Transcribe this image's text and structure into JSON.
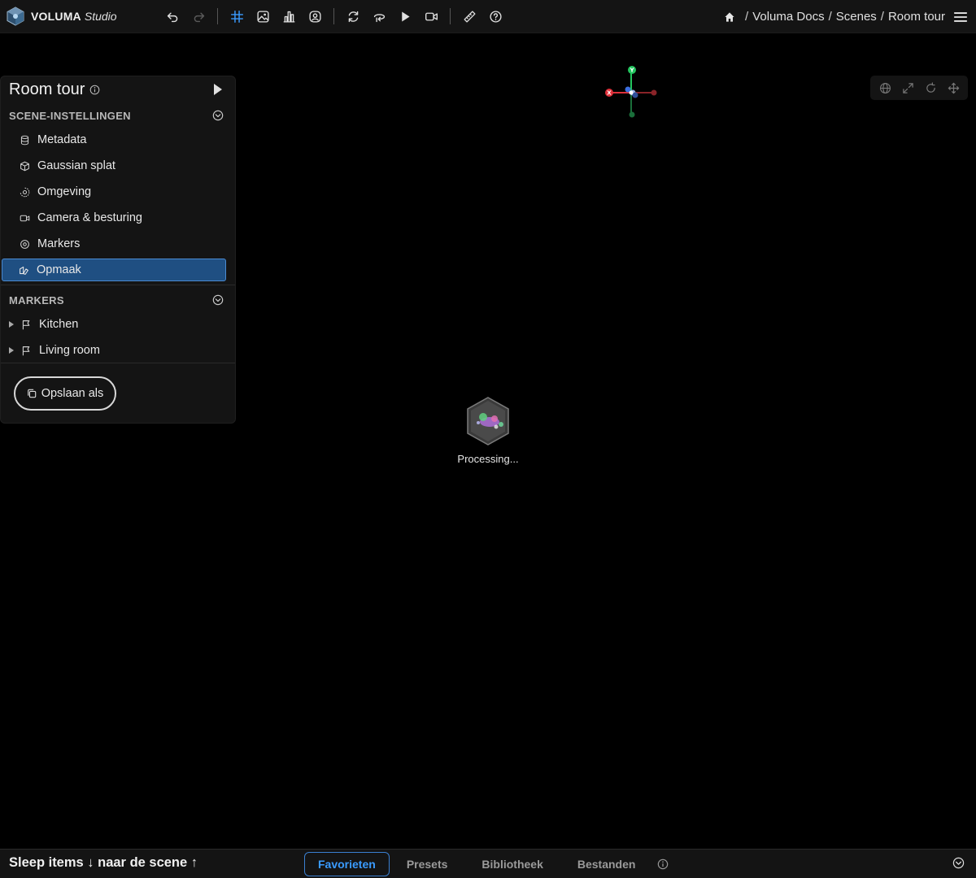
{
  "app": {
    "brand_name": "VOLUMA",
    "brand_sub": "Studio"
  },
  "toolbar": {
    "icons": [
      "undo-icon",
      "redo-icon",
      "grid-icon",
      "image-icon",
      "chart-icon",
      "user-circle-icon",
      "refresh-icon",
      "reset-view-icon",
      "play-icon",
      "video-camera-icon",
      "ruler-icon",
      "help-icon"
    ],
    "active_icon": "grid-icon",
    "accent": "#3a9bff"
  },
  "breadcrumb": {
    "items": [
      "Voluma Docs",
      "Scenes",
      "Room tour"
    ]
  },
  "panel": {
    "title": "Room tour",
    "scene_section": {
      "label": "SCENE-INSTELLINGEN",
      "items": [
        {
          "label": "Metadata",
          "icon": "database-icon"
        },
        {
          "label": "Gaussian splat",
          "icon": "cube-icon"
        },
        {
          "label": "Omgeving",
          "icon": "environment-icon"
        },
        {
          "label": "Camera & besturing",
          "icon": "camera-icon"
        },
        {
          "label": "Markers",
          "icon": "location-pin-icon"
        },
        {
          "label": "Opmaak",
          "icon": "palette-icon",
          "active": true
        }
      ]
    },
    "markers_section": {
      "label": "MARKERS",
      "items": [
        {
          "label": "Kitchen",
          "icon": "flag-icon"
        },
        {
          "label": "Living room",
          "icon": "flag-icon"
        }
      ]
    },
    "save_label": "Opslaan als"
  },
  "gizmo": {
    "x_label": "X",
    "y_label": "Y",
    "z_label": "Z"
  },
  "view_controls": [
    "globe-icon",
    "expand-icon",
    "rotate-icon",
    "move-icon"
  ],
  "viewport": {
    "status": "Processing..."
  },
  "bottom": {
    "drag_hint": "Sleep items ↓ naar de scene ↑",
    "tabs": [
      "Favorieten",
      "Presets",
      "Bibliotheek",
      "Bestanden"
    ],
    "active_tab": "Favorieten"
  },
  "colors": {
    "selection_bg": "#1f4f82",
    "selection_border": "#4a8ad0",
    "axis_x": "#e0303a",
    "axis_y": "#22c55e",
    "axis_z": "#3b6fe0"
  }
}
